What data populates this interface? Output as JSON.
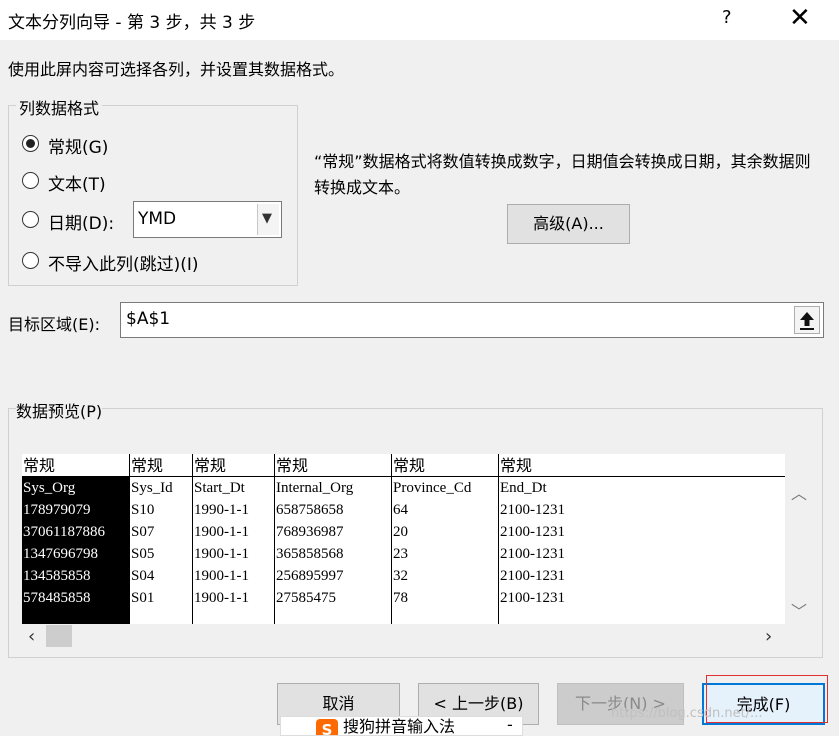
{
  "window": {
    "title": "文本分列向导 - 第 3 步，共 3 步",
    "help": "?",
    "close": "✕"
  },
  "instruction": "使用此屏内容可选择各列，并设置其数据格式。",
  "format_group": {
    "title": "列数据格式",
    "options": [
      {
        "label": "常规(G)",
        "checked": true
      },
      {
        "label": "文本(T)",
        "checked": false
      },
      {
        "label": "日期(D):",
        "checked": false
      },
      {
        "label": "不导入此列(跳过)(I)",
        "checked": false
      }
    ],
    "date_format": "YMD"
  },
  "description": "“常规”数据格式将数值转换成数字，日期值会转换成日期，其余数据则转换成文本。",
  "advanced_button": "高级(A)...",
  "target": {
    "label": "目标区域(E):",
    "value": "$A$1"
  },
  "preview": {
    "title": "数据预览(P)",
    "columns": [
      {
        "type": "常规",
        "cells": [
          "Sys_Org",
          "178979079",
          "37061187886",
          "1347696798",
          "134585858",
          "578485858"
        ],
        "selected": true
      },
      {
        "type": "常规",
        "cells": [
          "Sys_Id",
          "S10",
          "S07",
          "S05",
          "S04",
          "S01"
        ]
      },
      {
        "type": "常规",
        "cells": [
          "Start_Dt",
          "1990-1-1",
          "1900-1-1",
          "1900-1-1",
          "1900-1-1",
          "1900-1-1"
        ]
      },
      {
        "type": "常规",
        "cells": [
          "Internal_Org",
          "658758658",
          "768936987",
          "365858568",
          "256895997",
          "27585475"
        ]
      },
      {
        "type": "常规",
        "cells": [
          "Province_Cd",
          "64",
          "20",
          "23",
          "32",
          "78"
        ]
      },
      {
        "type": "常规",
        "cells": [
          "End_Dt",
          "2100-1231",
          "2100-1231",
          "2100-1231",
          "2100-1231",
          "2100-1231"
        ]
      }
    ]
  },
  "buttons": {
    "cancel": "取消",
    "back": "< 上一步(B)",
    "next": "下一步(N) >",
    "finish": "完成(F)"
  },
  "ime": {
    "logo": "S",
    "name": "搜狗拼音输入法",
    "dash": "-"
  },
  "watermark": "https://blog.csdn.net/..."
}
